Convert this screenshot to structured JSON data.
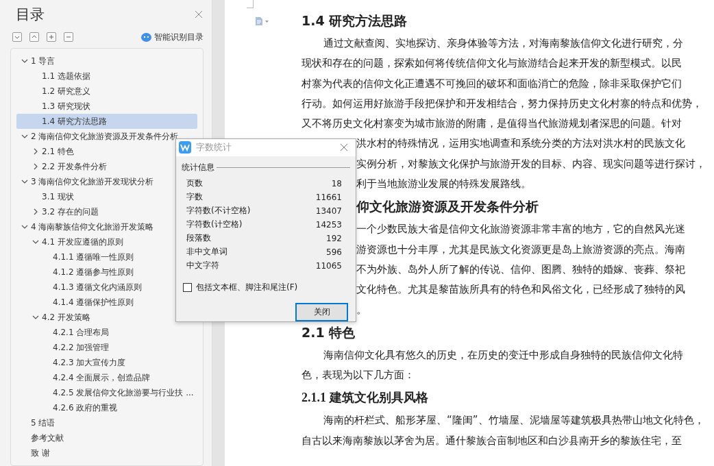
{
  "toc_panel": {
    "title": "目录",
    "smart_label": "智能识别目录",
    "tree": [
      {
        "label": "1  导言",
        "expanded": true,
        "selected": false,
        "children": [
          {
            "label": "1.1 选题依据",
            "selected": false
          },
          {
            "label": "1.2 研究意义",
            "selected": false
          },
          {
            "label": "1.3 研究现状",
            "selected": false
          },
          {
            "label": "1.4 研究方法思路",
            "selected": true
          }
        ]
      },
      {
        "label": "2  海南信仰文化旅游资源及开发条件分析",
        "expanded": true,
        "selected": false,
        "children": [
          {
            "label": "2.1 特色",
            "expanded": false,
            "selected": false
          },
          {
            "label": "2.2 开发条件分析",
            "expanded": false,
            "selected": false
          }
        ]
      },
      {
        "label": "3  海南信仰文化旅游开发现状分析",
        "expanded": true,
        "selected": false,
        "children": [
          {
            "label": "3.1 现状",
            "selected": false
          },
          {
            "label": "3.2 存在的问题",
            "expanded": false,
            "selected": false
          }
        ]
      },
      {
        "label": "4  海南黎族信仰文化旅游开发策略",
        "expanded": true,
        "selected": false,
        "children": [
          {
            "label": "4.1 开发应遵循的原则",
            "expanded": true,
            "selected": false,
            "children": [
              {
                "label": "4.1.1 遵循唯一性原则",
                "selected": false
              },
              {
                "label": "4.1.2 遵循参与性原则",
                "selected": false
              },
              {
                "label": "4.1.3 遵循文化内涵原则",
                "selected": false
              },
              {
                "label": "4.1.4 遵循保护性原则",
                "selected": false
              }
            ]
          },
          {
            "label": "4.2 开发策略",
            "expanded": true,
            "selected": false,
            "children": [
              {
                "label": "4.2.1 合理布局",
                "selected": false
              },
              {
                "label": "4.2.2 加强管理",
                "selected": false
              },
              {
                "label": "4.2.3 加大宣传力度",
                "selected": false
              },
              {
                "label": "4.2.4 全面展示，创造品牌",
                "selected": false
              },
              {
                "label": "4.2.5 发展信仰文化旅游要与行业扶 ...",
                "selected": false
              },
              {
                "label": "4.2.6 政府的重视",
                "selected": false
              }
            ]
          }
        ]
      },
      {
        "label": "5  结语",
        "selected": false
      },
      {
        "label": "参考文献",
        "selected": false
      },
      {
        "label": "致  谢",
        "selected": false
      }
    ]
  },
  "document": [
    {
      "kind": "h2",
      "text": "1.4 研究方法思路"
    },
    {
      "kind": "p",
      "indent": true,
      "text": "通过文献查阅、实地探访、亲身体验等方法，对海南黎族信仰文化进行研究，分"
    },
    {
      "kind": "p",
      "indent": false,
      "text": "现状和存在的问题，探索如何将传统信仰文化与旅游结合起来开发的新型模式。以民"
    },
    {
      "kind": "p",
      "indent": false,
      "text": "村寨为代表的信仰文化正遭遇不可挽回的破坏和面临消亡的危险，除非采取保护它们"
    },
    {
      "kind": "p",
      "indent": false,
      "text": "行动。如何运用好旅游手段把保护和开发相结合，努力保持历史文化村寨的特点和优势，"
    },
    {
      "kind": "p",
      "indent": false,
      "text": "又不将历史文化村寨变为城市旅游的附庸，是值得当代旅游规划者深思的问题。针对"
    },
    {
      "kind": "pc",
      "indent": false,
      "text": "洪水村的特殊情况，运用实地调查和系统分类的方法对洪水村的民族文化"
    },
    {
      "kind": "pc",
      "indent": false,
      "text": "实例分析，对黎族文化保护与旅游开发的目标、内容、现实问题等进行探讨，"
    },
    {
      "kind": "pc",
      "indent": false,
      "text": "利于当地旅游业发展的特殊发展路线。"
    },
    {
      "kind": "h2c",
      "text": "仰文化旅游资源及开发条件分析"
    },
    {
      "kind": "pc",
      "indent": false,
      "text": "一个少数民族大省是信仰文化旅游资源非常丰富的地方，它的自然风光迷"
    },
    {
      "kind": "pc",
      "indent": false,
      "text": "游资源也十分丰厚，尤其是民族文化资源更是岛上旅游资源的亮点。海南"
    },
    {
      "kind": "pc",
      "indent": false,
      "text": "不为外族、岛外人所了解的传说、信仰、图腾、独特的婚嫁、丧葬、祭祀"
    },
    {
      "kind": "pc",
      "indent": false,
      "text": "文化特色。尤其是黎苗族所具有的特色和风俗文化，已经形成了独特的风"
    },
    {
      "kind": "pc",
      "indent": false,
      "text": "。"
    },
    {
      "kind": "h2",
      "text": "2.1 特色"
    },
    {
      "kind": "p",
      "indent": true,
      "text": "海南信仰文化具有悠久的历史，在历史的变迁中形成自身独特的民族信仰文化特"
    },
    {
      "kind": "p",
      "indent": false,
      "text": "色，表现为以下几方面："
    },
    {
      "kind": "h3",
      "text": "2.1.1 建筑文化别具风格"
    },
    {
      "kind": "p",
      "indent": true,
      "text": "海南的杆栏式、船形茅屋、“隆闺”、竹墙屋、泥墙屋等建筑极具热带山地文化特色，"
    },
    {
      "kind": "p",
      "indent": false,
      "text": "自古以来海南黎族以茅舍为居。通什黎族合亩制地区和白沙县南开乡的黎族住宅，至"
    }
  ],
  "dialog": {
    "title": "字数统计",
    "group": "统计信息",
    "stats": [
      {
        "label": "页数",
        "value": "18"
      },
      {
        "label": "字数",
        "value": "11661"
      },
      {
        "label": "字符数(不计空格)",
        "value": "13407"
      },
      {
        "label": "字符数(计空格)",
        "value": "14253"
      },
      {
        "label": "段落数",
        "value": "192"
      },
      {
        "label": "非中文单词",
        "value": "596"
      },
      {
        "label": "中文字符",
        "value": "11065"
      }
    ],
    "include_option": {
      "label": "包括文本框、脚注和尾注(F)",
      "checked": false
    },
    "close_button": "关闭"
  }
}
